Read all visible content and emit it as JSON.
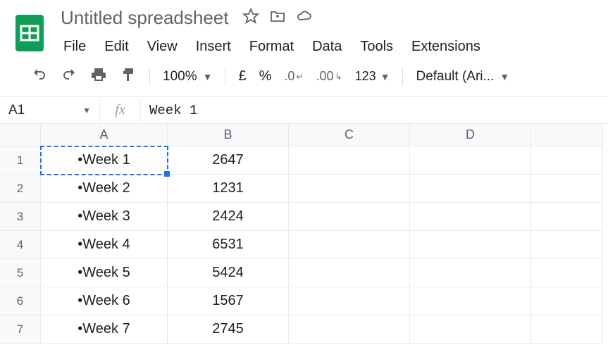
{
  "header": {
    "title": "Untitled spreadsheet",
    "menu": [
      "File",
      "Edit",
      "View",
      "Insert",
      "Format",
      "Data",
      "Tools",
      "Extensions"
    ]
  },
  "toolbar": {
    "zoom": "100%",
    "currency_symbol": "£",
    "percent": "%",
    "dec_decrease": ".0",
    "dec_increase": ".00",
    "number_format": "123",
    "font": "Default (Ari..."
  },
  "formula_bar": {
    "namebox": "A1",
    "fx_label": "fx",
    "formula": "Week 1"
  },
  "grid": {
    "columns": [
      "A",
      "B",
      "C",
      "D"
    ],
    "row_headers": [
      "1",
      "2",
      "3",
      "4",
      "5",
      "6",
      "7"
    ],
    "active_cell": "A1",
    "rows": [
      {
        "A": "•Week 1",
        "B": "2647"
      },
      {
        "A": "•Week 2",
        "B": "1231"
      },
      {
        "A": "•Week 3",
        "B": "2424"
      },
      {
        "A": "•Week 4",
        "B": "6531"
      },
      {
        "A": "•Week 5",
        "B": "5424"
      },
      {
        "A": "•Week 6",
        "B": "1567"
      },
      {
        "A": "•Week 7",
        "B": "2745"
      }
    ]
  }
}
